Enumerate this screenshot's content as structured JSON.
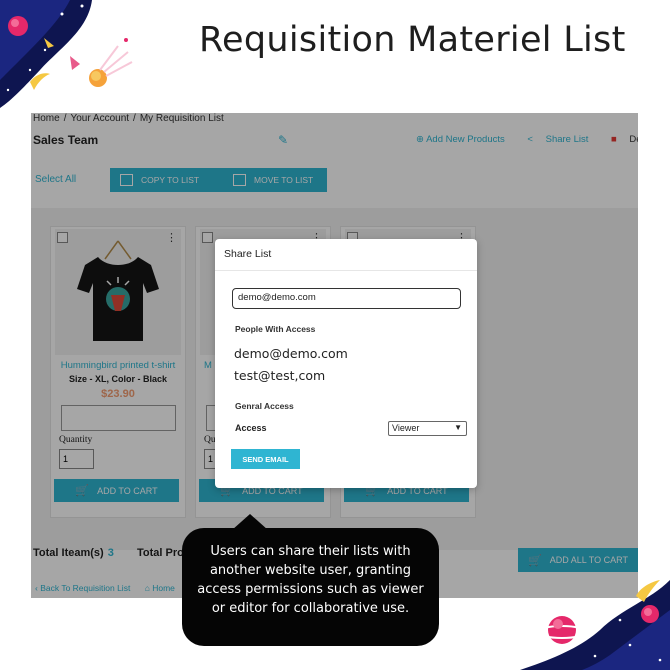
{
  "heading": "Requisition Materiel List",
  "breadcrumb": [
    "Home",
    "/",
    "Your Account",
    "/",
    "My Requisition List"
  ],
  "list_name": "Sales Team",
  "top_links": {
    "add_new": "Add New Products",
    "share": "Share List",
    "delete": "Delete List"
  },
  "toolbar": {
    "select_all": "Select All",
    "copy": "COPY TO LIST",
    "move": "MOVE TO LIST"
  },
  "product": {
    "name": "Hummingbird printed t-shirt",
    "variant": "Size - XL, Color - Black",
    "price": "$23.90",
    "qty_label": "Quantity",
    "qty_value": "1",
    "add_to_cart": "ADD TO CART"
  },
  "card2_partial": {
    "name": "M",
    "qty_label": "Qu",
    "qty_value": "1"
  },
  "add_to_cart_label": "ADD TO CART",
  "totals": {
    "items_label": "Total Iteam(s)",
    "items_value": "3",
    "products_label": "Total Pro"
  },
  "add_all": "ADD ALL TO CART",
  "footer": {
    "back": "Back To Requisition List",
    "home": "Home"
  },
  "modal": {
    "title": "Share List",
    "email_value": "demo@demo.com",
    "people_label": "People With Access",
    "people": [
      "demo@demo.com",
      "test@test,com"
    ],
    "general_label": "Genral Access",
    "access_label": "Access",
    "access_value": "Viewer",
    "send": "SEND EMAIL"
  },
  "callout": "Users can share their lists with another website user, granting access permissions such as viewer or editor for collaborative use.",
  "colors": {
    "accent": "#2fb5d2",
    "price": "#f39d72",
    "callout_bg": "#050505"
  }
}
